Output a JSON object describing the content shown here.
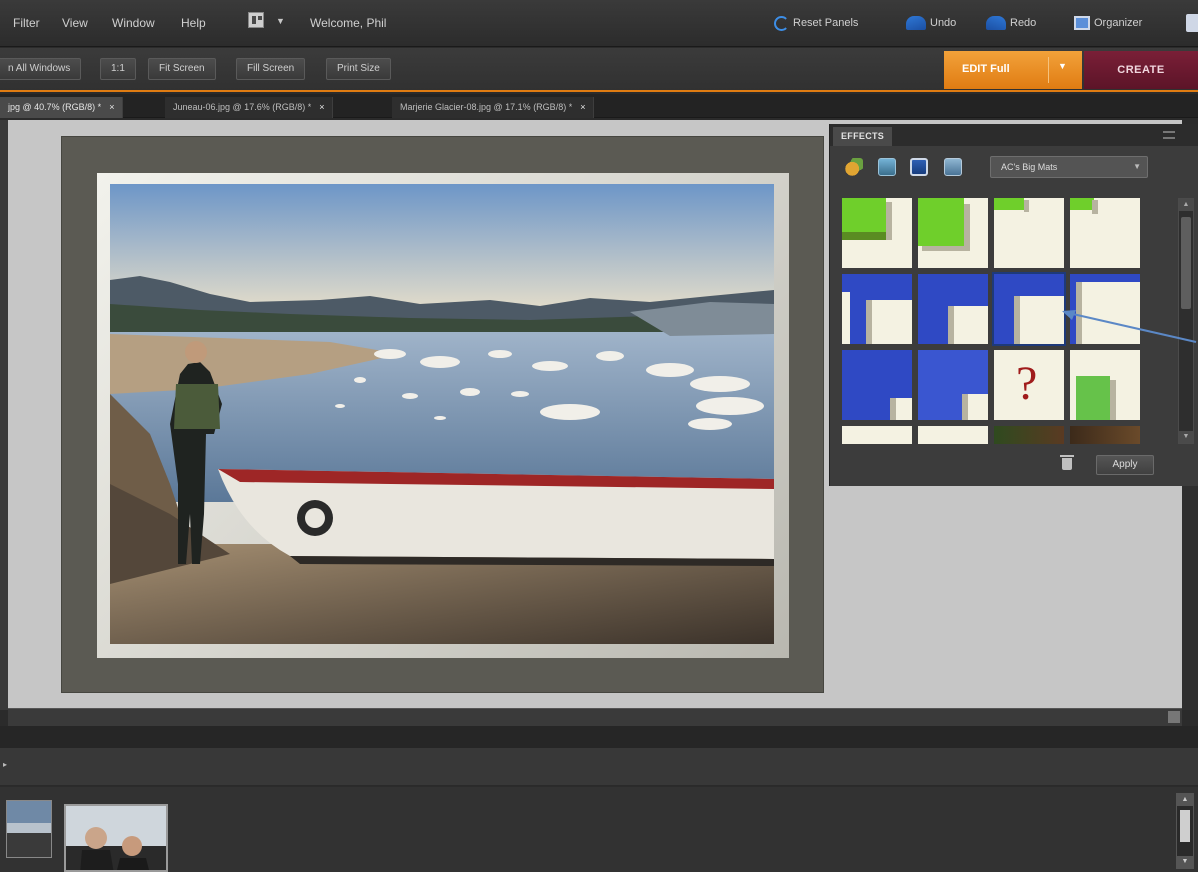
{
  "menu": {
    "items": [
      "Filter",
      "View",
      "Window",
      "Help"
    ],
    "welcome": "Welcome, Phil",
    "reset_panels": "Reset Panels",
    "undo": "Undo",
    "redo": "Redo",
    "organizer": "Organizer"
  },
  "options_bar": {
    "buttons": [
      "n All Windows",
      "1:1",
      "Fit Screen",
      "Fill Screen",
      "Print Size"
    ],
    "edit_full": "EDIT Full",
    "create": "CREATE"
  },
  "doc_tabs": [
    {
      "label": "jpg @ 40.7% (RGB/8) *",
      "close": "×",
      "active": true
    },
    {
      "label": "Juneau-06.jpg @ 17.6% (RGB/8) *",
      "close": "×",
      "active": false
    },
    {
      "label": "Marjerie Glacier-08.jpg @ 17.1% (RGB/8) *",
      "close": "×",
      "active": false
    }
  ],
  "effects_panel": {
    "tab": "EFFECTS",
    "category": "AC's Big Mats",
    "apply": "Apply",
    "question_mark": "?",
    "icons": [
      "filters-icon",
      "layer-styles-icon",
      "photo-effects-icon",
      "frames-icon"
    ]
  },
  "colors": {
    "edit_orange": "#e07c12",
    "create_maroon": "#6a1830",
    "mat_green": "#6fcf2b",
    "mat_blue": "#2f49c4",
    "mat_cream": "#f4f2e2",
    "annotation_arrow": "#5b88c6"
  }
}
